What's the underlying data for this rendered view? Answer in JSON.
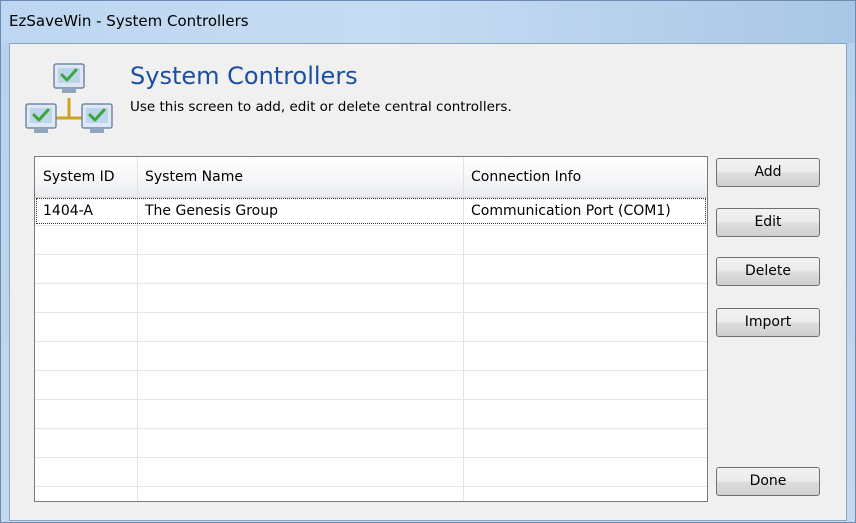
{
  "window": {
    "title": "EzSaveWin - System Controllers"
  },
  "header": {
    "icon": "network-computers-icon",
    "title": "System Controllers",
    "subtitle": "Use this screen to add, edit or delete central controllers."
  },
  "grid": {
    "columns": [
      "System ID",
      "System Name",
      "Connection Info"
    ],
    "rows": [
      {
        "system_id": "1404-A",
        "system_name": "The Genesis Group",
        "connection_info": "Communication Port (COM1)"
      }
    ]
  },
  "buttons": {
    "add": "Add",
    "edit": "Edit",
    "delete": "Delete",
    "import": "Import",
    "done": "Done"
  },
  "colors": {
    "title_blue": "#1d4fa1",
    "titlebar": "#c4daf1",
    "check_green": "#3aa63a"
  }
}
